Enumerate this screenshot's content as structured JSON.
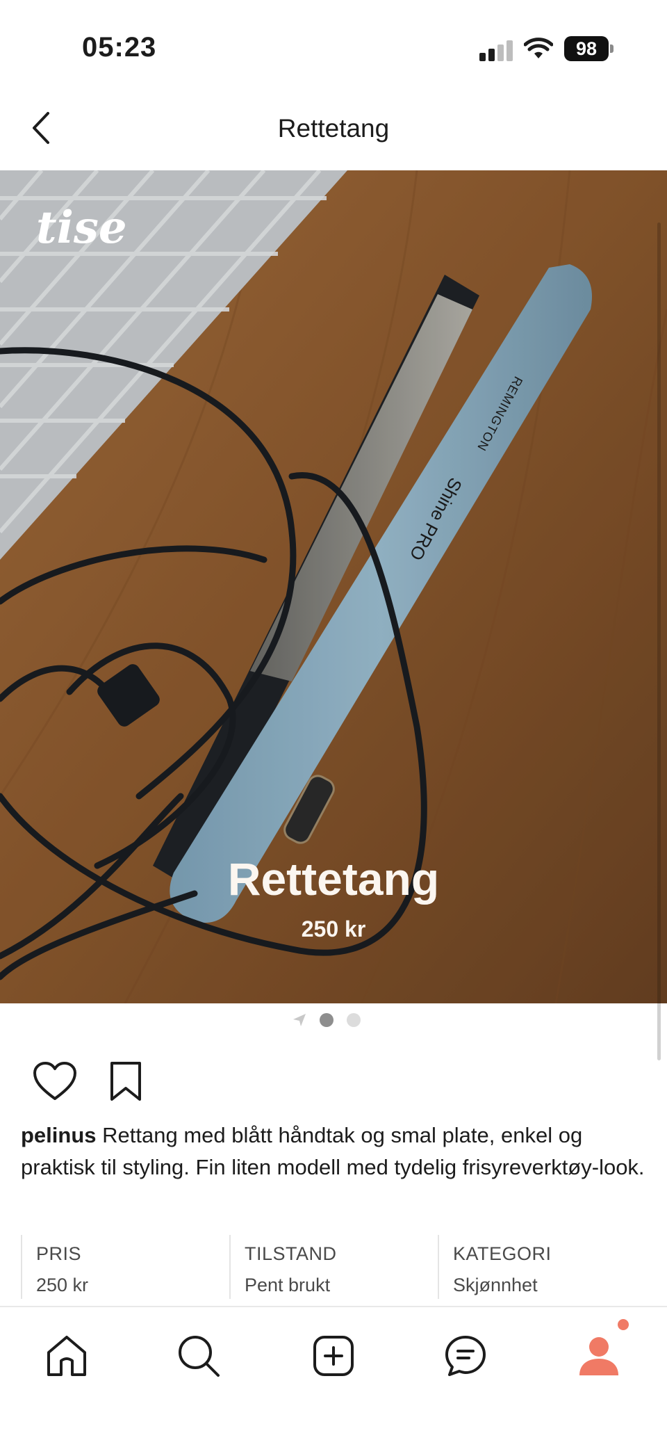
{
  "status_bar": {
    "time": "05:23",
    "battery": "98"
  },
  "nav": {
    "title": "Rettetang"
  },
  "product": {
    "brand_logo": "tise",
    "overlay_title": "Rettetang",
    "overlay_price": "250 kr",
    "device_brand": "REMINGTON",
    "device_model": "Shine PRO"
  },
  "description": {
    "username": "pelinus",
    "text": " Rettang med blått håndtak og smal plate, enkel og praktisk til styling. Fin liten modell med tydelig frisyreverktøy-look."
  },
  "details": [
    {
      "label": "PRIS",
      "value": "250 kr"
    },
    {
      "label": "TILSTAND",
      "value": "Pent brukt"
    },
    {
      "label": "KATEGORI",
      "value": "Skjønnhet"
    }
  ],
  "pagination": {
    "count": 2,
    "active": 0
  },
  "colors": {
    "accent": "#f07a65",
    "text": "#1c1c1c",
    "wood": "#8a5a2e",
    "handle": "#8fb0c4"
  },
  "icons": {
    "back": "chevron-left-icon",
    "like": "heart-icon",
    "save": "bookmark-icon",
    "home": "home-icon",
    "search": "search-icon",
    "add": "plus-square-icon",
    "messages": "chat-icon",
    "profile": "user-icon"
  }
}
